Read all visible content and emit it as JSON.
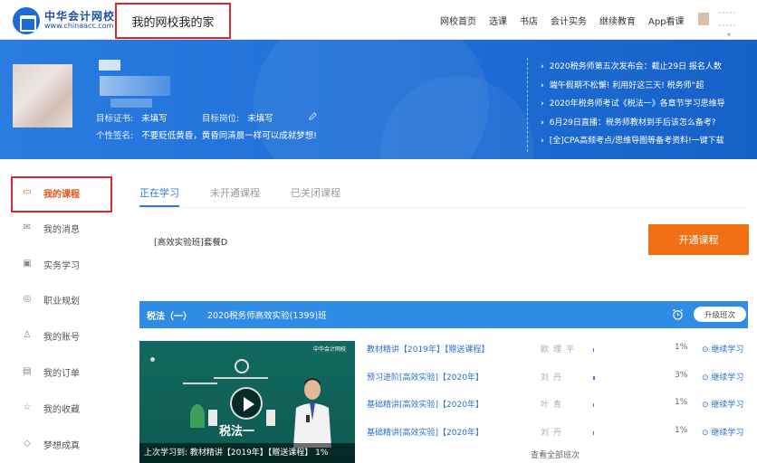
{
  "header": {
    "logo_cn": "中华会计网校",
    "logo_en": "www.chinaacc.com",
    "site_title": "我的网校我的家",
    "nav": [
      "网校首页",
      "选课",
      "书店",
      "会计实务",
      "继续教育",
      "App看课"
    ]
  },
  "profile": {
    "cert_label": "目标证书:",
    "cert_value": "未填写",
    "post_label": "目标岗位:",
    "post_value": "未填写",
    "sign_label": "个性签名:",
    "sign_value": "不要贬低黄昏，黄昏同清晨一样可以成就梦想!"
  },
  "news": [
    "2020税务师第五次发布会：截止29日 报名人数",
    "端午假期不松懈! 利用好这三天! 税务师“超",
    "2020年税务师考试《税法一》各章节学习思维导",
    "6月29日直播：税务师教材到手后该怎么备考?",
    "[全]CPA高频考点/思维导图等备考资料!一键下载"
  ],
  "sidebar": {
    "items": [
      {
        "label": "我的课程",
        "icon": "monitor-icon",
        "active": true
      },
      {
        "label": "我的消息",
        "icon": "mail-icon",
        "active": false
      },
      {
        "label": "实务学习",
        "icon": "book-icon",
        "active": false
      },
      {
        "label": "职业规划",
        "icon": "compass-icon",
        "active": false
      },
      {
        "label": "我的账号",
        "icon": "user-icon",
        "active": false
      },
      {
        "label": "我的订单",
        "icon": "order-icon",
        "active": false
      },
      {
        "label": "我的收藏",
        "icon": "star-icon",
        "active": false
      },
      {
        "label": "梦想成真",
        "icon": "dream-icon",
        "active": false
      }
    ]
  },
  "tabs": [
    "正在学习",
    "未开通课程",
    "已关闭课程"
  ],
  "package": {
    "name": "[高效实验班]套餐D",
    "open_button": "开通课程"
  },
  "course": {
    "subject": "税法（一）",
    "class_name": "2020税务师高效实验(1399)班",
    "upgrade_button": "升级班次",
    "video": {
      "brand": "中华会计网校",
      "title": "税法一",
      "caption": "上次学习到:  教材精讲【2019年】【赠送课程】 1%"
    },
    "lessons": [
      {
        "name": "教材精讲【2019年】【赠送课程】",
        "teacher": "欧理平",
        "progress": 1,
        "percent": "1%",
        "action": "继续学习"
      },
      {
        "name": "预习进阶[高效实验]【2020年】",
        "teacher": "刘丹",
        "progress": 3,
        "percent": "3%",
        "action": "继续学习"
      },
      {
        "name": "基础精讲[高效实验]【2020年】",
        "teacher": "叶青",
        "progress": 1,
        "percent": "1%",
        "action": "继续学习"
      },
      {
        "name": "基础精讲[高效实验]【2020年】",
        "teacher": "刘丹",
        "progress": 1,
        "percent": "1%",
        "action": "继续学习"
      }
    ],
    "view_all": "查看全部班次"
  },
  "colors": {
    "brand_blue": "#2a7ce0",
    "accent_orange": "#f07014",
    "highlight_red": "#e0262b"
  }
}
